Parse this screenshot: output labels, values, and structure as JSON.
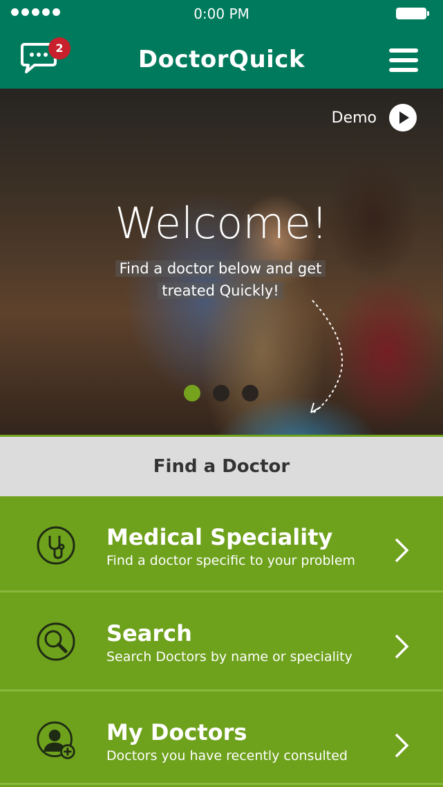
{
  "status_bar": {
    "time": "0:00 PM"
  },
  "header": {
    "title": "DoctorQuick",
    "message_badge_count": "2",
    "brand_color": "#007a5c",
    "badge_color": "#c8202c",
    "left_icon": "chat-bubble-icon",
    "right_icon": "hamburger-menu-icon"
  },
  "hero": {
    "demo_label": "Demo",
    "welcome": "Welcome!",
    "tagline_line1": "Find a doctor below and get",
    "tagline_line2": "treated Quickly!",
    "carousel": {
      "total": 3,
      "active": 1,
      "active_color": "#76a31e"
    }
  },
  "find_section": {
    "label": "Find a Doctor"
  },
  "menu": {
    "accent_color": "#6ea11c",
    "items": [
      {
        "title": "Medical Speciality",
        "subtitle": "Find a doctor specific to your problem",
        "icon": "stethoscope-icon"
      },
      {
        "title": "Search",
        "subtitle": "Search Doctors by name or speciality",
        "icon": "magnifier-icon"
      },
      {
        "title": "My Doctors",
        "subtitle": "Doctors you have recently consulted",
        "icon": "user-plus-icon"
      }
    ]
  }
}
